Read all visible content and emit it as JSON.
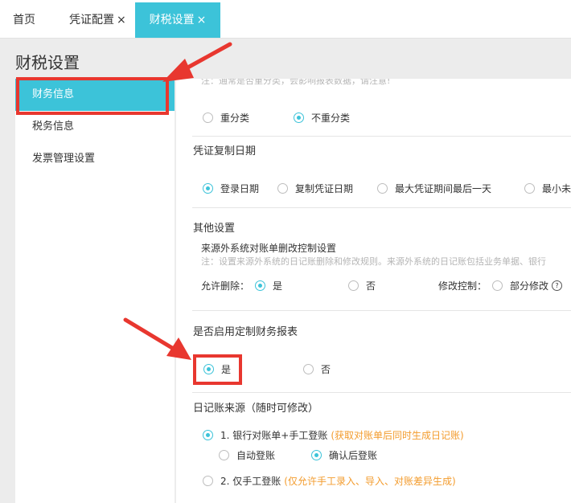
{
  "tabs": {
    "home": "首页",
    "voucher_config": "凭证配置",
    "finance_tax_settings": "财税设置",
    "close": "×"
  },
  "page_title": "财税设置",
  "nav": {
    "finance_info": "财务信息",
    "tax_info": "税务信息",
    "invoice_settings": "发票管理设置"
  },
  "reclass": {
    "note": "注：通常是否重分类，会影响报表数据，请注意!",
    "options": [
      "重分类",
      "不重分类"
    ],
    "selected": "不重分类"
  },
  "copy_date": {
    "title": "凭证复制日期",
    "options": [
      "登录日期",
      "复制凭证日期",
      "最大凭证期间最后一天",
      "最小未"
    ],
    "selected": "登录日期"
  },
  "other": {
    "title": "其他设置",
    "subtitle": "来源外系统对账单删改控制设置",
    "note": "注：设置来源外系统的日记账删除和修改规则。来源外系统的日记账包括业务单据、银行",
    "allow_delete_label": "允许删除：",
    "allow_delete_options": [
      "是",
      "否"
    ],
    "allow_delete_selected": "是",
    "modify_control_label": "修改控制：",
    "modify_control_option": "部分修改",
    "help_icon": "?"
  },
  "custom_report": {
    "title": "是否启用定制财务报表",
    "options": [
      "是",
      "否"
    ],
    "selected": "是"
  },
  "journal_source": {
    "title": "日记账来源（随时可修改）",
    "option1": "1. 银行对账单+手工登账",
    "option1_hint": "(获取对账单后同时生成日记账)",
    "option1_sub": [
      "自动登账",
      "确认后登账"
    ],
    "option1_sub_selected": "确认后登账",
    "option2": "2. 仅手工登账",
    "option2_hint": "(仅允许手工录入、导入、对账差异生成)",
    "selected": "1. 银行对账单+手工登账"
  },
  "colors": {
    "accent": "#3cc3d9",
    "annotation_red": "#e8372f",
    "hint_orange": "#f39c2e"
  }
}
